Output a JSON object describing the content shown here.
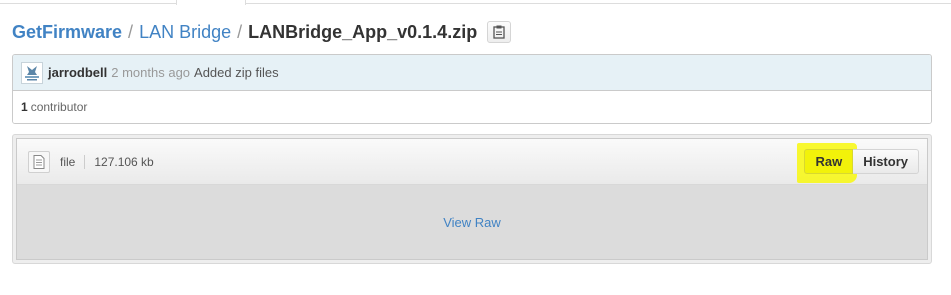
{
  "breadcrumb": {
    "repo": "GetFirmware",
    "separator": "/",
    "folder": "LAN Bridge",
    "file": "LANBridge_App_v0.1.4.zip",
    "copy_icon": "clipboard-icon"
  },
  "commit": {
    "avatar_icon": "user-avatar-icon",
    "author": "jarrodbell",
    "time": "2 months ago",
    "message": "Added zip files",
    "contributor_count": "1",
    "contributor_label": "contributor"
  },
  "file": {
    "icon": "file-icon",
    "type": "file",
    "size": "127.106 kb",
    "raw_label": "Raw",
    "history_label": "History",
    "view_raw_label": "View Raw"
  },
  "colors": {
    "link": "#4183c4",
    "commit_bar": "#e6f1f6",
    "highlight": "#f2f20a"
  }
}
